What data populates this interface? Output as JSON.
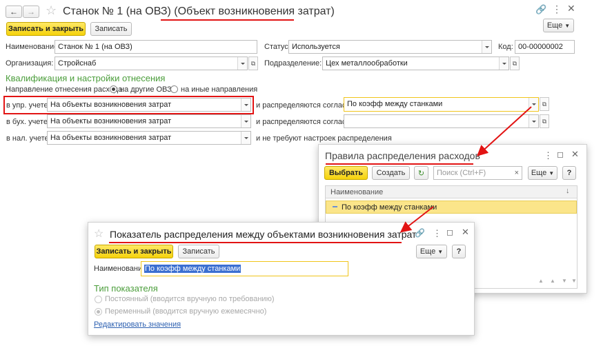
{
  "main": {
    "title_prefix": "Станок № 1 (на ОВЗ)",
    "title_type": "(Объект возникновения затрат)",
    "save_close": "Записать и закрыть",
    "save": "Записать",
    "more": "Еще",
    "name_label": "Наименование:",
    "name_value": "Станок № 1 (на ОВЗ)",
    "status_label": "Статус:",
    "status_value": "Используется",
    "code_label": "Код:",
    "code_value": "00-00000002",
    "org_label": "Организация:",
    "org_value": "Стройснаб",
    "dept_label": "Подразделение:",
    "dept_value": "Цех металлообработки",
    "section_title": "Квалификация и настройки отнесения",
    "direction_label": "Направление отнесения расхода:",
    "direction_opt1": "на другие ОВЗ",
    "direction_opt2": "на иные направления",
    "mgmt_label": "в упр. учете:",
    "mgmt_value": "На объекты возникновения затрат",
    "mgmt_dist_label": "и распределяются согласно:",
    "mgmt_dist_value": "По коэфф между станками",
    "acc_label": "в бух. учете:",
    "acc_value": "На объекты возникновения затрат",
    "acc_dist_label": "и распределяются согласно:",
    "acc_dist_value": "",
    "tax_label": "в нал. учете:",
    "tax_value": "На объекты возникновения затрат",
    "tax_note": "и не требуют настроек распределения"
  },
  "rules_window": {
    "title": "Правила распределения расходов",
    "select": "Выбрать",
    "create": "Создать",
    "search_placeholder": "Поиск (Ctrl+F)",
    "more": "Еще",
    "help": "?",
    "col_name": "Наименование",
    "row1": "По коэфф между станками"
  },
  "indicator_window": {
    "title": "Показатель распределения между объектами возникновения затрат",
    "save_close": "Записать и закрыть",
    "save": "Записать",
    "more": "Еще",
    "help": "?",
    "name_label": "Наименование:",
    "name_value": "По коэфф между станками",
    "type_title": "Тип показателя",
    "type_opt1": "Постоянный (вводится вручную по требованию)",
    "type_opt2": "Переменный (вводится вручную ежемесячно)",
    "edit_link": "Редактировать значения"
  },
  "colors": {
    "accent_yellow": "#f5d20c",
    "annotation_red": "#e21313",
    "section_green": "#4a9d3a",
    "selected_row": "#fbe58a"
  }
}
